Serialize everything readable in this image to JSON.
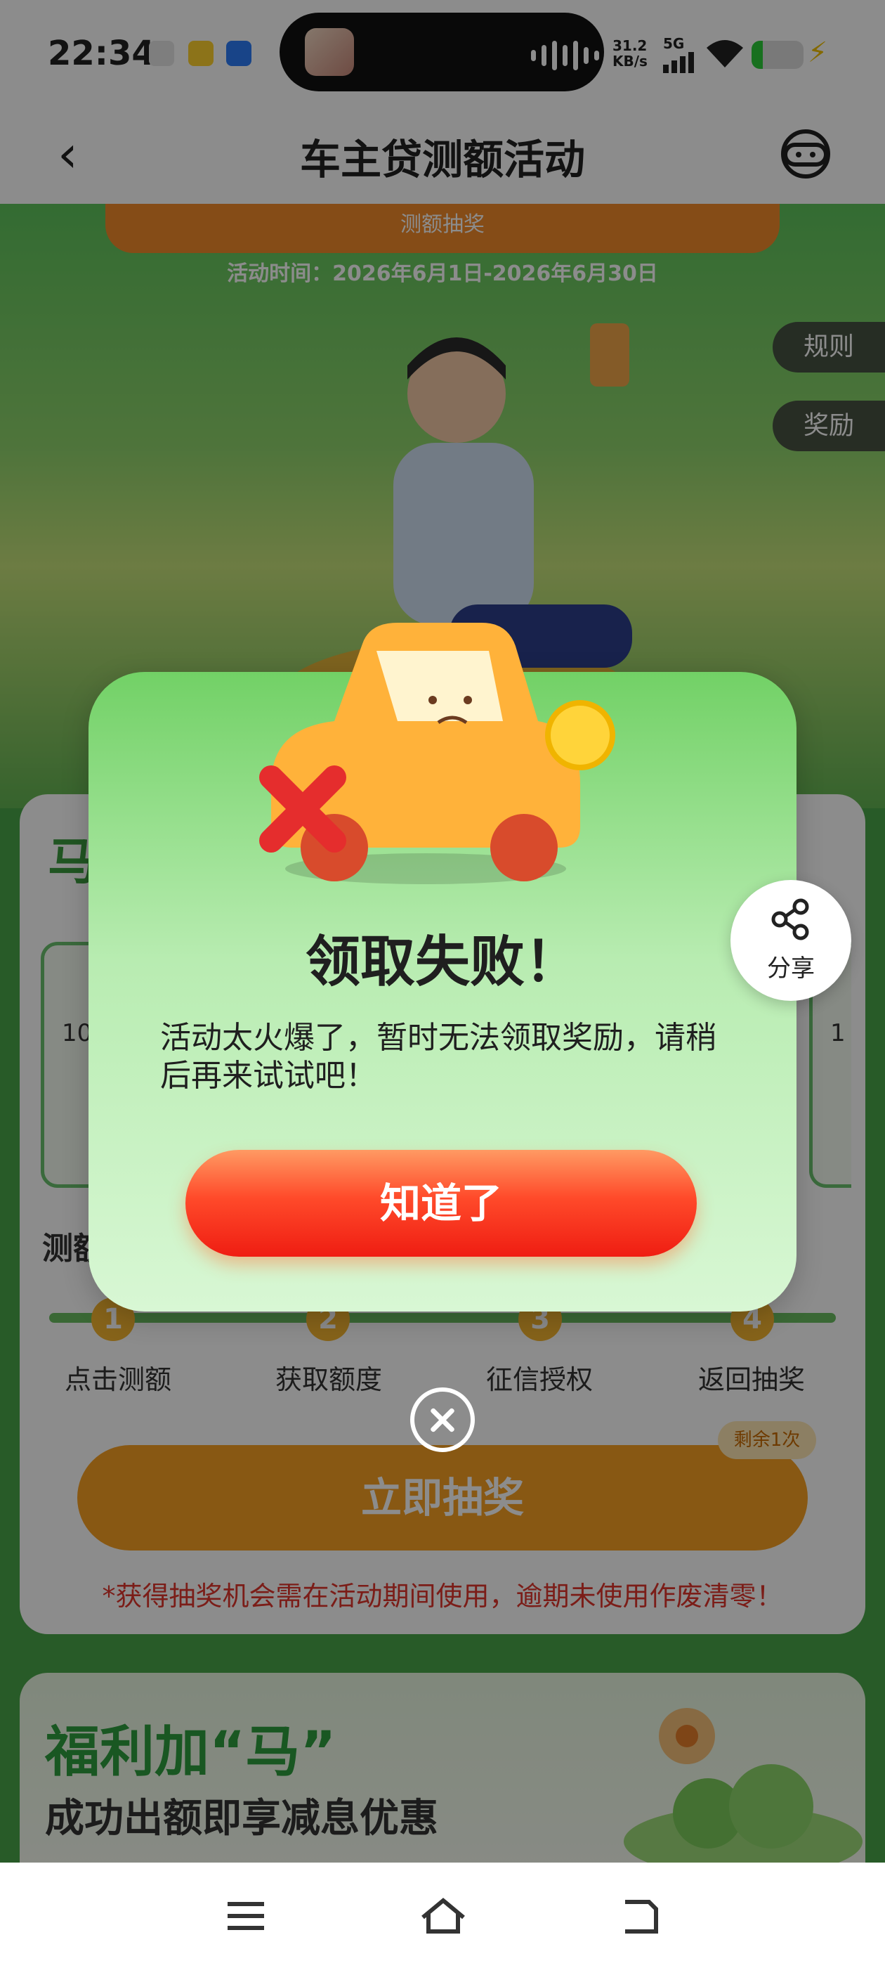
{
  "status_bar": {
    "time": "22:34",
    "net_speed": "31.2",
    "net_unit": "KB/s",
    "network": "5G"
  },
  "header": {
    "title": "车主贷测额活动"
  },
  "hero": {
    "ribbon_text": "测额抽奖",
    "activity_time": "活动时间：2026年6月1日-2026年6月30日",
    "rules_tab": "规则",
    "rewards_tab": "奖励"
  },
  "card": {
    "title": "马",
    "prize_left_amount": "10",
    "prize_right_amount": "1",
    "steps_title": "测额",
    "steps": [
      {
        "num": "1",
        "label": "点击测额"
      },
      {
        "num": "2",
        "label": "获取额度"
      },
      {
        "num": "3",
        "label": "征信授权"
      },
      {
        "num": "4",
        "label": "返回抽奖"
      }
    ],
    "draw_button": "立即抽奖",
    "remaining_badge": "剩余1次",
    "notice": "*获得抽奖机会需在活动期间使用，逾期未使用作废清零！"
  },
  "welfare": {
    "title": "福利加“马”",
    "subtitle": "成功出额即享减息优惠"
  },
  "dialog": {
    "title": "领取失败！",
    "message": "活动太火爆了，暂时无法领取奖励，请稍后再来试试吧！",
    "confirm_button": "知道了"
  },
  "share": {
    "label": "分享"
  },
  "colors": {
    "page_green": "#4aa64a",
    "dialog_green": "#72d166",
    "button_red": "#ef1d12",
    "button_orange": "#f7a124",
    "notice_red": "#e0362d"
  }
}
